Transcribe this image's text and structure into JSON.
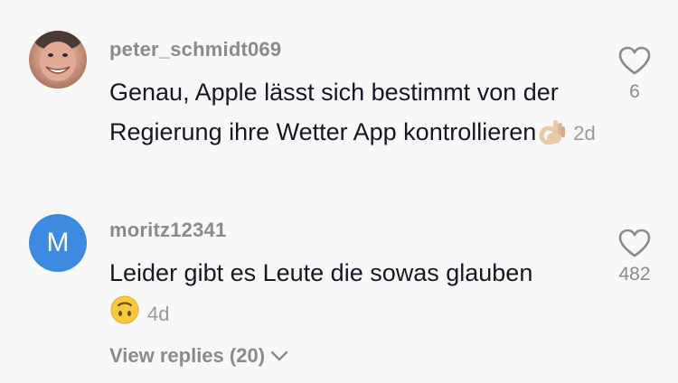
{
  "comments": [
    {
      "username": "peter_schmidt069",
      "avatar_icon": "user-photo-avatar",
      "text": "Genau, Apple lässt sich bestimmt von der Regierung ihre Wetter App kontrollieren",
      "emoji_icon": "ok-hand-emoji",
      "emoji": "👌🏼",
      "time": "2d",
      "likes": "6"
    },
    {
      "username": "moritz12341",
      "avatar_letter": "M",
      "avatar_color": "#3d8be0",
      "text": "Leider gibt es Leute die sowas glauben",
      "emoji_icon": "upside-down-face-emoji",
      "emoji": "🙃",
      "time": "4d",
      "likes": "482"
    }
  ],
  "view_replies": {
    "label": "View replies (20)",
    "icon": "chevron-down-icon"
  }
}
